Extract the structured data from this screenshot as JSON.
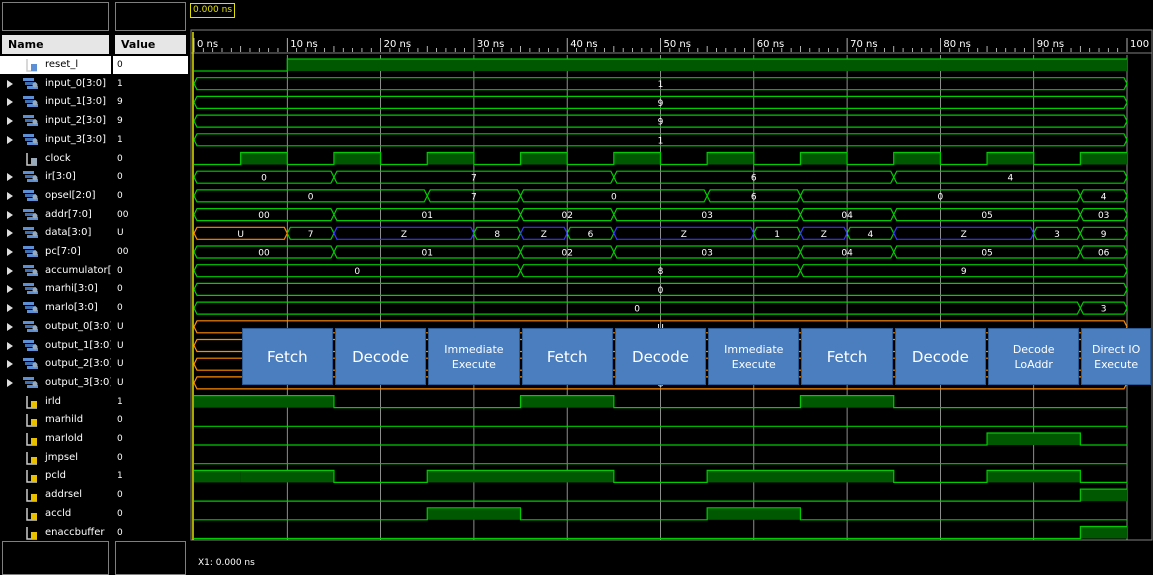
{
  "header": {
    "name_label": "Name",
    "value_label": "Value",
    "cursor_time": "0.000 ns",
    "x1_readout": "X1: 0.000 ns"
  },
  "time_axis": {
    "unit": "ns",
    "start": 0,
    "end": 100,
    "labels": [
      "0 ns",
      "10 ns",
      "20 ns",
      "30 ns",
      "40 ns",
      "50 ns",
      "60 ns",
      "70 ns",
      "80 ns",
      "90 ns",
      "100 ns"
    ]
  },
  "colors": {
    "wave": "#00cc00",
    "bus": "#00cc00",
    "z_bus": "#3737ff",
    "u_bus": "#ff8a00",
    "cursor": "#e0e000",
    "phase_box": "#4b7ebf"
  },
  "signals": [
    {
      "name": "reset_l",
      "value": "0",
      "kind": "bit",
      "expand": false,
      "icon": "bit-in-icon",
      "selected": true,
      "edges": [
        [
          0,
          0
        ],
        [
          10,
          1
        ]
      ]
    },
    {
      "name": "input_0[3:0]",
      "value": "1",
      "kind": "bus",
      "expand": true,
      "icon": "bus-icon",
      "segs": [
        [
          0,
          100,
          "1"
        ]
      ]
    },
    {
      "name": "input_1[3:0]",
      "value": "9",
      "kind": "bus",
      "expand": true,
      "icon": "bus-icon",
      "segs": [
        [
          0,
          100,
          "9"
        ]
      ]
    },
    {
      "name": "input_2[3:0]",
      "value": "9",
      "kind": "bus",
      "expand": true,
      "icon": "bus-icon",
      "segs": [
        [
          0,
          100,
          "9"
        ]
      ]
    },
    {
      "name": "input_3[3:0]",
      "value": "1",
      "kind": "bus",
      "expand": true,
      "icon": "bus-icon",
      "segs": [
        [
          0,
          100,
          "1"
        ]
      ]
    },
    {
      "name": "clock",
      "value": "0",
      "kind": "clock",
      "expand": false,
      "icon": "bit-icon",
      "period": 10,
      "first_rise": 5
    },
    {
      "name": "ir[3:0]",
      "value": "0",
      "kind": "bus",
      "expand": true,
      "icon": "bus-icon",
      "segs": [
        [
          0,
          15,
          "0"
        ],
        [
          15,
          45,
          "7"
        ],
        [
          45,
          75,
          "6"
        ],
        [
          75,
          100,
          "4"
        ]
      ]
    },
    {
      "name": "opsel[2:0]",
      "value": "0",
      "kind": "bus",
      "expand": true,
      "icon": "bus-icon",
      "segs": [
        [
          0,
          25,
          "0"
        ],
        [
          25,
          35,
          "7"
        ],
        [
          35,
          55,
          "0"
        ],
        [
          55,
          65,
          "6"
        ],
        [
          65,
          95,
          "0"
        ],
        [
          95,
          100,
          "4"
        ]
      ]
    },
    {
      "name": "addr[7:0]",
      "value": "00",
      "kind": "bus",
      "expand": true,
      "icon": "bus-icon",
      "segs": [
        [
          0,
          15,
          "00"
        ],
        [
          15,
          35,
          "01"
        ],
        [
          35,
          45,
          "02"
        ],
        [
          45,
          65,
          "03"
        ],
        [
          65,
          75,
          "04"
        ],
        [
          75,
          95,
          "05"
        ],
        [
          95,
          100,
          "03"
        ]
      ]
    },
    {
      "name": "data[3:0]",
      "value": "U",
      "kind": "bus",
      "expand": true,
      "icon": "bus-icon",
      "segs": [
        [
          0,
          10,
          "U",
          "u"
        ],
        [
          10,
          15,
          "7"
        ],
        [
          15,
          30,
          "Z",
          "z"
        ],
        [
          30,
          35,
          "8"
        ],
        [
          35,
          40,
          "Z",
          "z"
        ],
        [
          40,
          45,
          "6"
        ],
        [
          45,
          60,
          "Z",
          "z"
        ],
        [
          60,
          65,
          "1"
        ],
        [
          65,
          70,
          "Z",
          "z"
        ],
        [
          70,
          75,
          "4"
        ],
        [
          75,
          90,
          "Z",
          "z"
        ],
        [
          90,
          95,
          "3"
        ],
        [
          95,
          100,
          "9"
        ]
      ]
    },
    {
      "name": "pc[7:0]",
      "value": "00",
      "kind": "bus",
      "expand": true,
      "icon": "bus-icon",
      "segs": [
        [
          0,
          15,
          "00"
        ],
        [
          15,
          35,
          "01"
        ],
        [
          35,
          45,
          "02"
        ],
        [
          45,
          65,
          "03"
        ],
        [
          65,
          75,
          "04"
        ],
        [
          75,
          95,
          "05"
        ],
        [
          95,
          100,
          "06"
        ]
      ]
    },
    {
      "name": "accumulator[3:0]",
      "value": "0",
      "kind": "bus",
      "expand": true,
      "icon": "bus-icon",
      "segs": [
        [
          0,
          35,
          "0"
        ],
        [
          35,
          65,
          "8"
        ],
        [
          65,
          100,
          "9"
        ]
      ]
    },
    {
      "name": "marhi[3:0]",
      "value": "0",
      "kind": "bus",
      "expand": true,
      "icon": "bus-icon",
      "segs": [
        [
          0,
          100,
          "0"
        ]
      ]
    },
    {
      "name": "marlo[3:0]",
      "value": "0",
      "kind": "bus",
      "expand": true,
      "icon": "bus-icon",
      "segs": [
        [
          0,
          95,
          "0"
        ],
        [
          95,
          100,
          "3"
        ]
      ]
    },
    {
      "name": "output_0[3:0]",
      "value": "U",
      "kind": "bus",
      "expand": true,
      "icon": "bus-icon",
      "segs": [
        [
          0,
          100,
          "U",
          "u"
        ]
      ]
    },
    {
      "name": "output_1[3:0]",
      "value": "U",
      "kind": "bus",
      "expand": true,
      "icon": "bus-icon",
      "segs": [
        [
          0,
          100,
          "U",
          "u"
        ]
      ]
    },
    {
      "name": "output_2[3:0]",
      "value": "U",
      "kind": "bus",
      "expand": true,
      "icon": "bus-icon",
      "segs": [
        [
          0,
          100,
          "U",
          "u"
        ]
      ]
    },
    {
      "name": "output_3[3:0]",
      "value": "U",
      "kind": "bus",
      "expand": true,
      "icon": "bus-icon",
      "segs": [
        [
          0,
          100,
          "U",
          "u"
        ]
      ]
    },
    {
      "name": "irld",
      "value": "1",
      "kind": "bit",
      "expand": false,
      "icon": "bit-out-icon",
      "edges": [
        [
          0,
          1
        ],
        [
          15,
          0
        ],
        [
          35,
          1
        ],
        [
          45,
          0
        ],
        [
          65,
          1
        ],
        [
          75,
          0
        ]
      ]
    },
    {
      "name": "marhild",
      "value": "0",
      "kind": "bit",
      "expand": false,
      "icon": "bit-out-icon",
      "edges": [
        [
          0,
          0
        ]
      ]
    },
    {
      "name": "marlold",
      "value": "0",
      "kind": "bit",
      "expand": false,
      "icon": "bit-out-icon",
      "edges": [
        [
          0,
          0
        ],
        [
          85,
          1
        ],
        [
          95,
          0
        ]
      ]
    },
    {
      "name": "jmpsel",
      "value": "0",
      "kind": "bit",
      "expand": false,
      "icon": "bit-out-icon",
      "edges": [
        [
          0,
          0
        ]
      ]
    },
    {
      "name": "pcld",
      "value": "1",
      "kind": "bit",
      "expand": false,
      "icon": "bit-out-icon",
      "edges": [
        [
          0,
          1
        ],
        [
          5,
          1
        ],
        [
          15,
          0
        ],
        [
          25,
          1
        ],
        [
          45,
          0
        ],
        [
          55,
          1
        ],
        [
          75,
          0
        ],
        [
          85,
          1
        ],
        [
          95,
          0
        ]
      ]
    },
    {
      "name": "addrsel",
      "value": "0",
      "kind": "bit",
      "expand": false,
      "icon": "bit-out-icon",
      "edges": [
        [
          0,
          0
        ],
        [
          95,
          1
        ]
      ]
    },
    {
      "name": "accld",
      "value": "0",
      "kind": "bit",
      "expand": false,
      "icon": "bit-out-icon",
      "edges": [
        [
          0,
          0
        ],
        [
          25,
          1
        ],
        [
          35,
          0
        ],
        [
          55,
          1
        ],
        [
          65,
          0
        ]
      ]
    },
    {
      "name": "enaccbuffer",
      "value": "0",
      "kind": "bit",
      "expand": false,
      "icon": "bit-out-icon",
      "edges": [
        [
          0,
          0
        ],
        [
          95,
          1
        ]
      ]
    }
  ],
  "phases": [
    {
      "label": "Fetch",
      "size": "big",
      "t0": 5,
      "t1": 15
    },
    {
      "label": "Decode",
      "size": "big",
      "t0": 15,
      "t1": 25
    },
    {
      "label": "Immediate\nExecute",
      "size": "small",
      "t0": 25,
      "t1": 35
    },
    {
      "label": "Fetch",
      "size": "big",
      "t0": 35,
      "t1": 45
    },
    {
      "label": "Decode",
      "size": "big",
      "t0": 45,
      "t1": 55
    },
    {
      "label": "Immediate\nExecute",
      "size": "small",
      "t0": 55,
      "t1": 65
    },
    {
      "label": "Fetch",
      "size": "big",
      "t0": 65,
      "t1": 75
    },
    {
      "label": "Decode",
      "size": "big",
      "t0": 75,
      "t1": 85
    },
    {
      "label": "Decode\nLoAddr",
      "size": "small",
      "t0": 85,
      "t1": 95
    },
    {
      "label": "Direct IO\nExecute",
      "size": "small",
      "t0": 95,
      "t1": 103
    }
  ]
}
